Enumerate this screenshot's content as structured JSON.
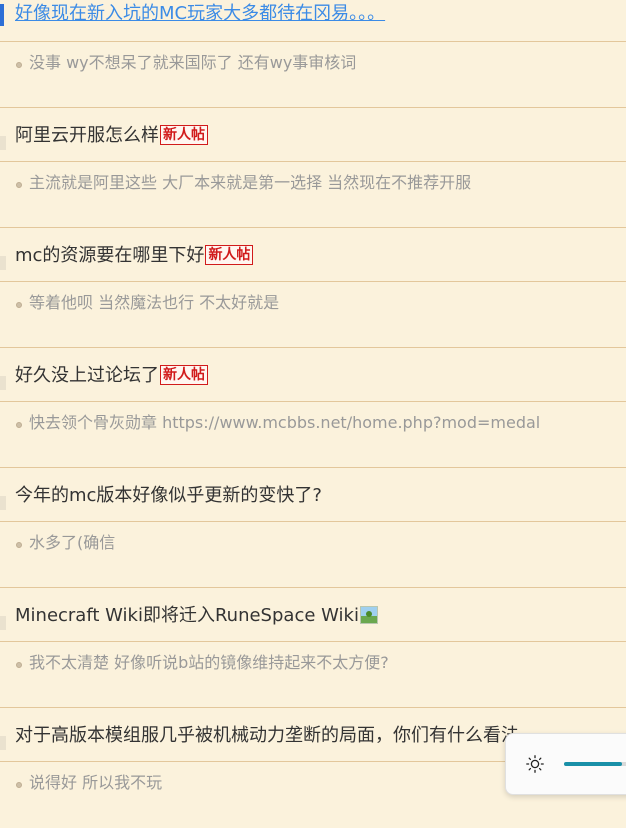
{
  "threads": [
    {
      "title": "好像现在新入坑的MC玩家大多都待在冈易。。。",
      "badge": "",
      "has_image_icon": false,
      "reply": "没事 wy不想呆了就来国际了 还有wy事审核词"
    },
    {
      "title": "阿里云开服怎么样",
      "badge": "新人帖",
      "has_image_icon": false,
      "reply": "主流就是阿里这些 大厂本来就是第一选择 当然现在不推荐开服"
    },
    {
      "title": "mc的资源要在哪里下好",
      "badge": "新人帖",
      "has_image_icon": false,
      "reply": "等着他呗 当然魔法也行 不太好就是"
    },
    {
      "title": "好久没上过论坛了",
      "badge": "新人帖",
      "has_image_icon": false,
      "reply": "快去领个骨灰勋章 https://www.mcbbs.net/home.php?mod=medal"
    },
    {
      "title": "今年的mc版本好像似乎更新的变快了?",
      "badge": "",
      "has_image_icon": false,
      "reply": "水多了(确信"
    },
    {
      "title": "Minecraft Wiki即将迁入RuneSpace Wiki",
      "badge": "",
      "has_image_icon": true,
      "reply": "我不太清楚 好像听说b站的镜像维持起来不太方便?"
    },
    {
      "title": "对于高版本模组服几乎被机械动力垄断的局面，你们有什么看法",
      "badge": "",
      "has_image_icon": false,
      "reply": "说得好 所以我不玩"
    }
  ],
  "brightness_widget": {
    "icon": "sun-icon",
    "level": 0.72,
    "accent_color": "#1a90a8"
  }
}
